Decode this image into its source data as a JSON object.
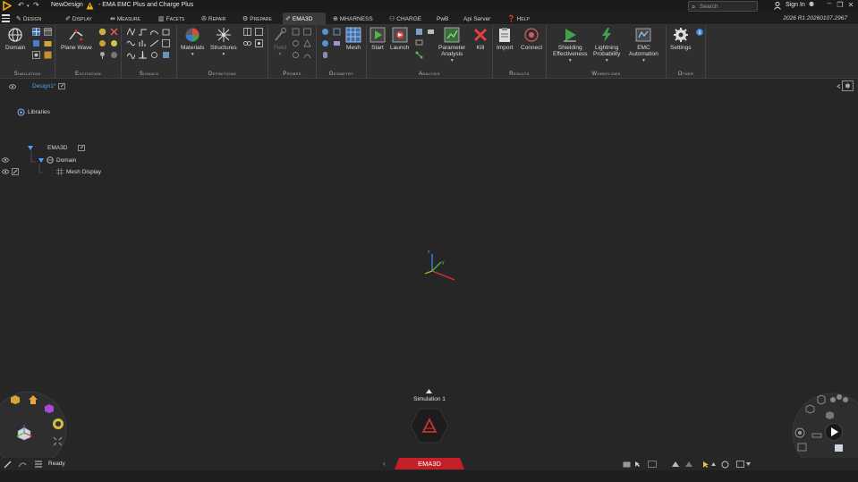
{
  "titlebar": {
    "design_name": "NewDesign",
    "app_title": "- EMA EMC Plus and Charge Plus",
    "search_placeholder": "Search",
    "sign_in": "Sign In"
  },
  "tabs": [
    {
      "label": "Design",
      "icon": "pencil-icon"
    },
    {
      "label": "Display",
      "icon": "brush-icon"
    },
    {
      "label": "Measure",
      "icon": "ruler-icon"
    },
    {
      "label": "Facets",
      "icon": "chart-icon"
    },
    {
      "label": "Repair",
      "icon": "wrench-icon"
    },
    {
      "label": "Prepare",
      "icon": "gear-icon"
    },
    {
      "label": "EMA3D",
      "icon": "brush-icon",
      "active": true
    },
    {
      "label": "MHARNESS",
      "icon": "globe-icon"
    },
    {
      "label": "CHARGE",
      "icon": "people-icon"
    },
    {
      "label": "PwB",
      "icon": ""
    },
    {
      "label": "Api Server",
      "icon": ""
    },
    {
      "label": "Help",
      "icon": "help-icon"
    }
  ],
  "version": "2026 R1 20260107.2967",
  "ribbon": {
    "simulation": {
      "label": "Simulation",
      "domain": "Domain"
    },
    "excitation": {
      "label": "Excitation",
      "plane_wave": "Plane Wave"
    },
    "signals": {
      "label": "Signals"
    },
    "definitions": {
      "label": "Definitions",
      "materials": "Materials",
      "structures": "Structures"
    },
    "probes": {
      "label": "Probes",
      "field": "Field"
    },
    "geometry": {
      "label": "Geometry",
      "mesh": "Mesh"
    },
    "analysis": {
      "label": "Analysis",
      "start": "Start",
      "launch": "Launch",
      "parameter_analysis_1": "Parameter",
      "parameter_analysis_2": "Analysis",
      "kill": "Kill"
    },
    "results": {
      "label": "Results",
      "import": "Import",
      "connect": "Connect"
    },
    "workflows": {
      "label": "Workflows",
      "shielding_1": "Shielding",
      "shielding_2": "Effectiveness",
      "lightning_1": "Lightning",
      "lightning_2": "Probability",
      "emc_1": "EMC",
      "emc_2": "Automation"
    },
    "other": {
      "label": "Other",
      "settings": "Settings"
    }
  },
  "tree": {
    "design": "Design1*",
    "libraries": "Libraries",
    "ema3d": "EMA3D",
    "domain": "Domain",
    "mesh_display": "Mesh Display"
  },
  "viewport": {
    "simulation_label": "Simulation 1",
    "ema3d_tab": "EMA3D"
  },
  "status": {
    "text": "Ready"
  },
  "colors": {
    "accent_red": "#c4202a",
    "link_blue": "#4fa3ff"
  }
}
